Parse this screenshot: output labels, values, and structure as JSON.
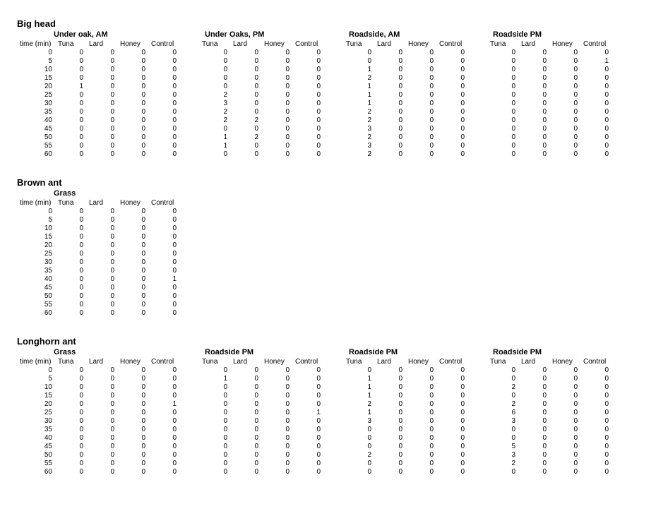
{
  "columns": [
    "Tuna",
    "Lard",
    "Honey",
    "Control"
  ],
  "time_header": "time (min)",
  "times": [
    0,
    5,
    10,
    15,
    20,
    25,
    30,
    35,
    40,
    45,
    50,
    55,
    60
  ],
  "sections": [
    {
      "name": "Big head",
      "blocks": [
        {
          "title": "Under oak, AM",
          "show_time": true,
          "rows": [
            [
              0,
              0,
              0,
              0
            ],
            [
              0,
              0,
              0,
              0
            ],
            [
              0,
              0,
              0,
              0
            ],
            [
              0,
              0,
              0,
              0
            ],
            [
              1,
              0,
              0,
              0
            ],
            [
              0,
              0,
              0,
              0
            ],
            [
              0,
              0,
              0,
              0
            ],
            [
              0,
              0,
              0,
              0
            ],
            [
              0,
              0,
              0,
              0
            ],
            [
              0,
              0,
              0,
              0
            ],
            [
              0,
              0,
              0,
              0
            ],
            [
              0,
              0,
              0,
              0
            ],
            [
              0,
              0,
              0,
              0
            ]
          ]
        },
        {
          "title": "Under Oaks, PM",
          "show_time": false,
          "rows": [
            [
              0,
              0,
              0,
              0
            ],
            [
              0,
              0,
              0,
              0
            ],
            [
              0,
              0,
              0,
              0
            ],
            [
              0,
              0,
              0,
              0
            ],
            [
              0,
              0,
              0,
              0
            ],
            [
              2,
              0,
              0,
              0
            ],
            [
              3,
              0,
              0,
              0
            ],
            [
              2,
              0,
              0,
              0
            ],
            [
              2,
              2,
              0,
              0
            ],
            [
              0,
              0,
              0,
              0
            ],
            [
              1,
              2,
              0,
              0
            ],
            [
              1,
              0,
              0,
              0
            ],
            [
              0,
              0,
              0,
              0
            ]
          ]
        },
        {
          "title": "Roadside, AM",
          "show_time": false,
          "rows": [
            [
              0,
              0,
              0,
              0
            ],
            [
              0,
              0,
              0,
              0
            ],
            [
              1,
              0,
              0,
              0
            ],
            [
              2,
              0,
              0,
              0
            ],
            [
              1,
              0,
              0,
              0
            ],
            [
              1,
              0,
              0,
              0
            ],
            [
              1,
              0,
              0,
              0
            ],
            [
              2,
              0,
              0,
              0
            ],
            [
              2,
              0,
              0,
              0
            ],
            [
              3,
              0,
              0,
              0
            ],
            [
              2,
              0,
              0,
              0
            ],
            [
              3,
              0,
              0,
              0
            ],
            [
              2,
              0,
              0,
              0
            ]
          ]
        },
        {
          "title": "Roadside PM",
          "show_time": false,
          "rows": [
            [
              0,
              0,
              0,
              0
            ],
            [
              0,
              0,
              0,
              1
            ],
            [
              0,
              0,
              0,
              0
            ],
            [
              0,
              0,
              0,
              0
            ],
            [
              0,
              0,
              0,
              0
            ],
            [
              0,
              0,
              0,
              0
            ],
            [
              0,
              0,
              0,
              0
            ],
            [
              0,
              0,
              0,
              0
            ],
            [
              0,
              0,
              0,
              0
            ],
            [
              0,
              0,
              0,
              0
            ],
            [
              0,
              0,
              0,
              0
            ],
            [
              0,
              0,
              0,
              0
            ],
            [
              0,
              0,
              0,
              0
            ]
          ]
        }
      ]
    },
    {
      "name": "Brown ant",
      "blocks": [
        {
          "title": "Grass",
          "show_time": true,
          "rows": [
            [
              0,
              0,
              0,
              0
            ],
            [
              0,
              0,
              0,
              0
            ],
            [
              0,
              0,
              0,
              0
            ],
            [
              0,
              0,
              0,
              0
            ],
            [
              0,
              0,
              0,
              0
            ],
            [
              0,
              0,
              0,
              0
            ],
            [
              0,
              0,
              0,
              0
            ],
            [
              0,
              0,
              0,
              0
            ],
            [
              0,
              0,
              0,
              1
            ],
            [
              0,
              0,
              0,
              0
            ],
            [
              0,
              0,
              0,
              0
            ],
            [
              0,
              0,
              0,
              0
            ],
            [
              0,
              0,
              0,
              0
            ]
          ]
        }
      ]
    },
    {
      "name": "Longhorn ant",
      "blocks": [
        {
          "title": "Grass",
          "show_time": true,
          "rows": [
            [
              0,
              0,
              0,
              0
            ],
            [
              0,
              0,
              0,
              0
            ],
            [
              0,
              0,
              0,
              0
            ],
            [
              0,
              0,
              0,
              0
            ],
            [
              0,
              0,
              0,
              1
            ],
            [
              0,
              0,
              0,
              0
            ],
            [
              0,
              0,
              0,
              0
            ],
            [
              0,
              0,
              0,
              0
            ],
            [
              0,
              0,
              0,
              0
            ],
            [
              0,
              0,
              0,
              0
            ],
            [
              0,
              0,
              0,
              0
            ],
            [
              0,
              0,
              0,
              0
            ],
            [
              0,
              0,
              0,
              0
            ]
          ]
        },
        {
          "title": "Roadside PM",
          "show_time": false,
          "rows": [
            [
              0,
              0,
              0,
              0
            ],
            [
              1,
              0,
              0,
              0
            ],
            [
              0,
              0,
              0,
              0
            ],
            [
              0,
              0,
              0,
              0
            ],
            [
              0,
              0,
              0,
              0
            ],
            [
              0,
              0,
              0,
              1
            ],
            [
              0,
              0,
              0,
              0
            ],
            [
              0,
              0,
              0,
              0
            ],
            [
              0,
              0,
              0,
              0
            ],
            [
              0,
              0,
              0,
              0
            ],
            [
              0,
              0,
              0,
              0
            ],
            [
              0,
              0,
              0,
              0
            ],
            [
              0,
              0,
              0,
              0
            ]
          ]
        },
        {
          "title": "Roadside PM",
          "show_time": false,
          "rows": [
            [
              0,
              0,
              0,
              0
            ],
            [
              1,
              0,
              0,
              0
            ],
            [
              1,
              0,
              0,
              0
            ],
            [
              1,
              0,
              0,
              0
            ],
            [
              2,
              0,
              0,
              0
            ],
            [
              1,
              0,
              0,
              0
            ],
            [
              3,
              0,
              0,
              0
            ],
            [
              0,
              0,
              0,
              0
            ],
            [
              0,
              0,
              0,
              0
            ],
            [
              0,
              0,
              0,
              0
            ],
            [
              2,
              0,
              0,
              0
            ],
            [
              0,
              0,
              0,
              0
            ],
            [
              0,
              0,
              0,
              0
            ]
          ]
        },
        {
          "title": "Roadside PM",
          "show_time": false,
          "rows": [
            [
              0,
              0,
              0,
              0
            ],
            [
              0,
              0,
              0,
              0
            ],
            [
              2,
              0,
              0,
              0
            ],
            [
              0,
              0,
              0,
              0
            ],
            [
              2,
              0,
              0,
              0
            ],
            [
              6,
              0,
              0,
              0
            ],
            [
              3,
              0,
              0,
              0
            ],
            [
              0,
              0,
              0,
              0
            ],
            [
              0,
              0,
              0,
              0
            ],
            [
              5,
              0,
              0,
              0
            ],
            [
              3,
              0,
              0,
              0
            ],
            [
              2,
              0,
              0,
              0
            ],
            [
              0,
              0,
              0,
              0
            ]
          ]
        }
      ]
    }
  ]
}
